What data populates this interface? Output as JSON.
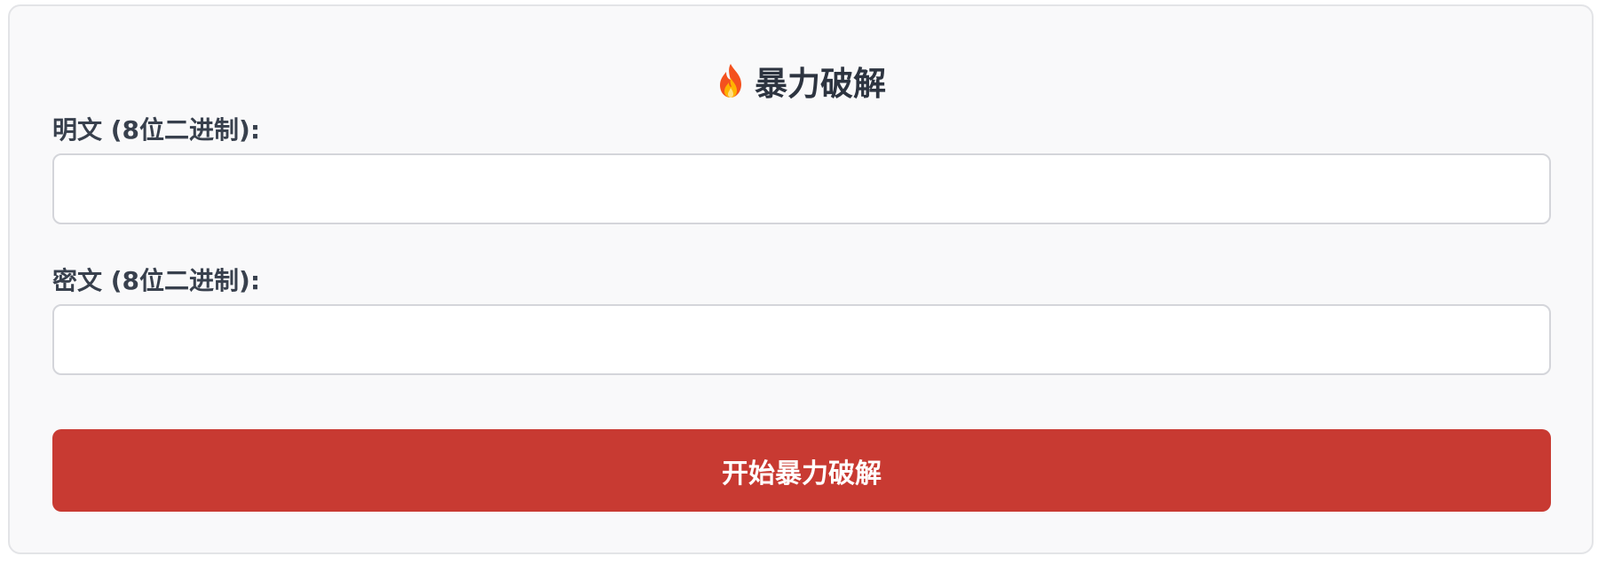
{
  "panel": {
    "title": "暴力破解",
    "title_icon": "flame-icon"
  },
  "plaintext": {
    "label": "明文 (8位二进制):",
    "value": "",
    "placeholder": ""
  },
  "ciphertext": {
    "label": "密文 (8位二进制):",
    "value": "",
    "placeholder": ""
  },
  "start_button": {
    "label": "开始暴力破解"
  },
  "colors": {
    "panel_background": "#f9f9fa",
    "panel_border": "#e3e4e7",
    "text_dark": "#2d3440",
    "button_background": "#c83a32",
    "button_text": "#ffffff"
  }
}
